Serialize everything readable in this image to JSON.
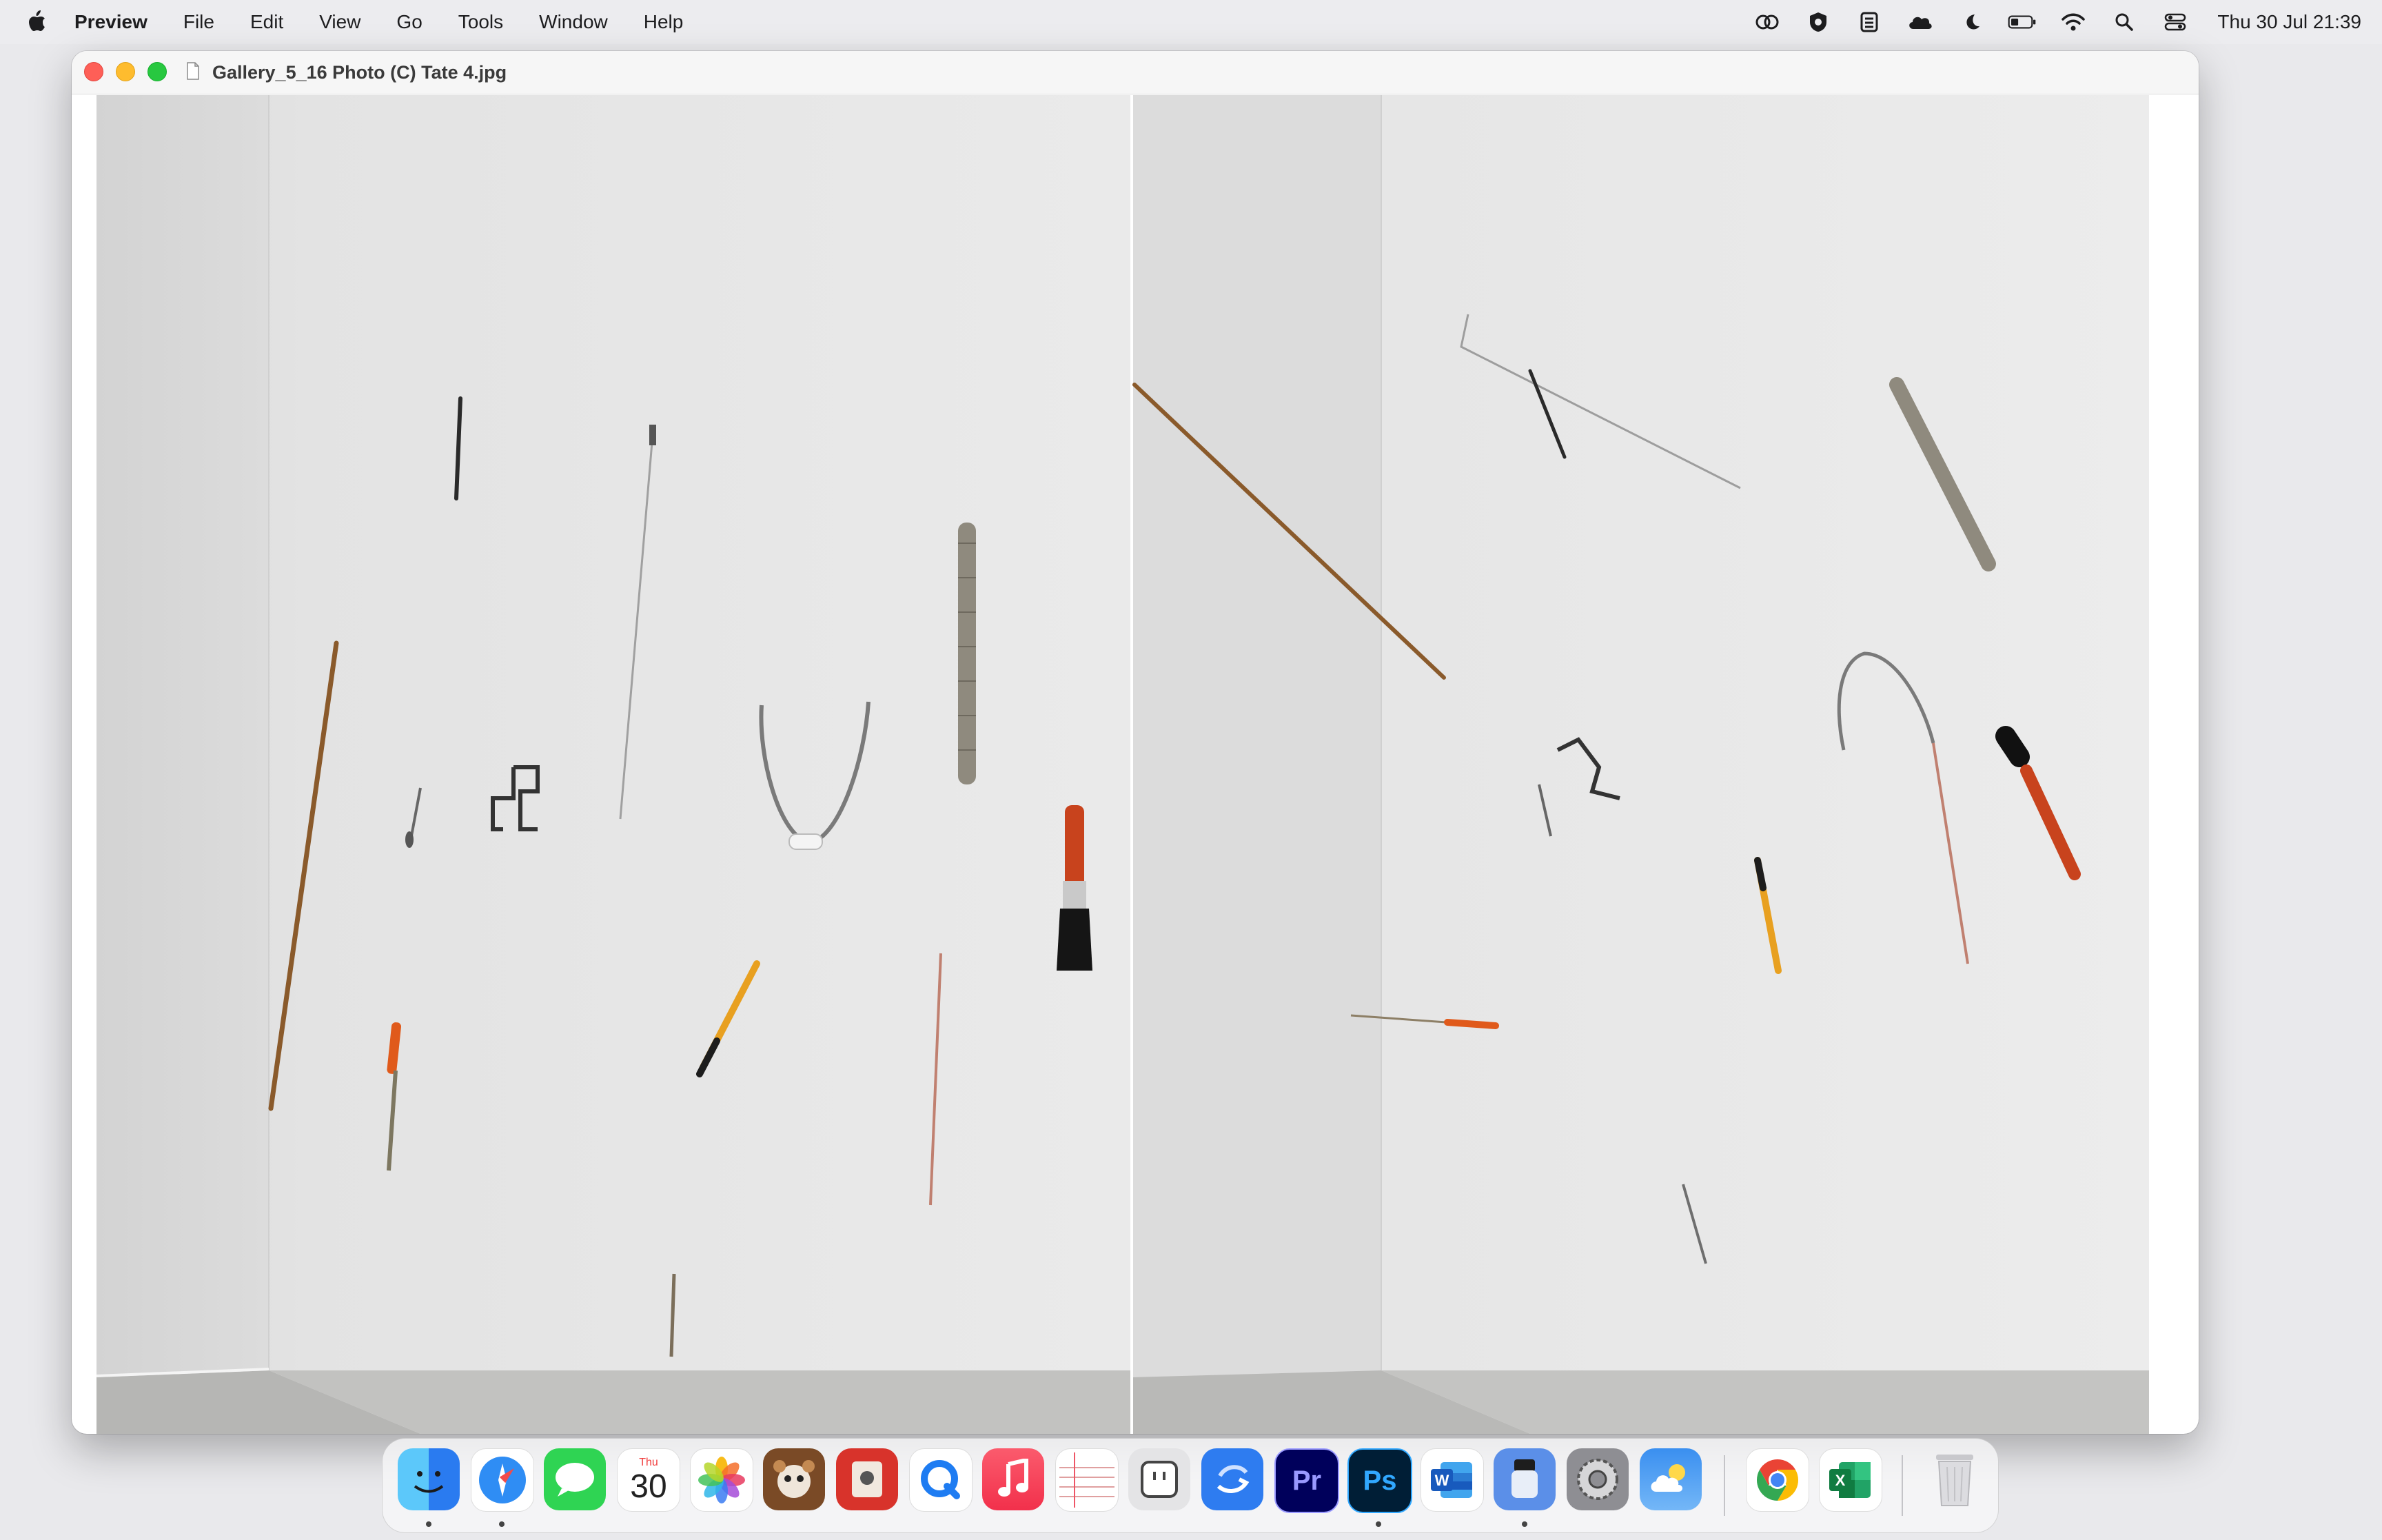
{
  "menubar": {
    "app_name": "Preview",
    "menus": [
      "File",
      "Edit",
      "View",
      "Go",
      "Tools",
      "Window",
      "Help"
    ],
    "status_icons": [
      "creative-cloud-icon",
      "vpn-shield-icon",
      "stats-icon",
      "cloud-icon",
      "moon-icon",
      "battery-icon",
      "wifi-icon",
      "search-icon",
      "control-center-icon"
    ],
    "clock": "Thu 30 Jul  21:39"
  },
  "window": {
    "title": "Gallery_5_16 Photo (C) Tate 4.jpg",
    "image_description_icon": "document-icon"
  },
  "dock": {
    "calendar_month": "Thu",
    "calendar_day": "30",
    "items": [
      "Finder",
      "Safari",
      "Messages",
      "Calendar",
      "Photos",
      "Mouse app",
      "Photo Booth",
      "QuickTime Player",
      "Music",
      "Notes",
      "Widget",
      "Migrate",
      "Premiere Pro",
      "Photoshop",
      "Word",
      "Disk",
      "System Settings",
      "Weather",
      "Chrome",
      "Excel",
      "Trash"
    ],
    "running_indicators": [
      "Finder",
      "Safari",
      "Photoshop",
      "Disk"
    ]
  },
  "colors": {
    "accent_red": "#fe5f57",
    "accent_yellow": "#febc2e",
    "accent_green": "#28c840",
    "wall": "#e8e8e8"
  }
}
